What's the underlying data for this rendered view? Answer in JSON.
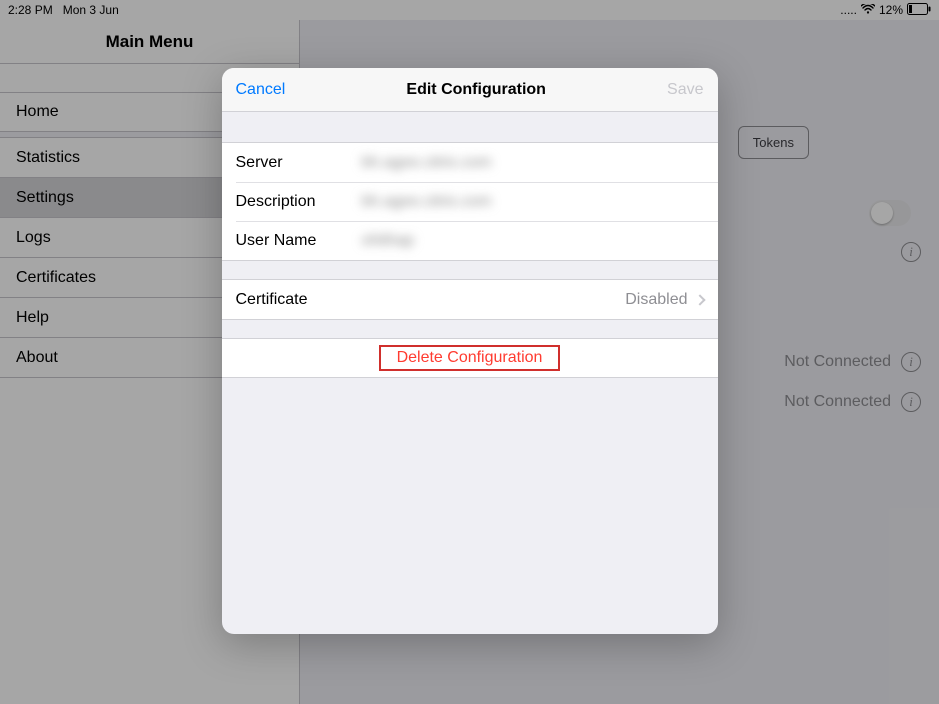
{
  "status": {
    "time": "2:28 PM",
    "date": "Mon 3 Jun",
    "cellular": ".....",
    "battery_pct": "12%"
  },
  "sidebar": {
    "title": "Main Menu",
    "items": [
      {
        "label": "Home"
      },
      {
        "label": "Statistics"
      },
      {
        "label": "Settings"
      },
      {
        "label": "Logs"
      },
      {
        "label": "Certificates"
      },
      {
        "label": "Help"
      },
      {
        "label": "About"
      }
    ]
  },
  "detail": {
    "tokens_button": "Tokens",
    "info_i": "i",
    "rows": [
      {
        "status": "Not Connected"
      },
      {
        "status": "Not Connected"
      }
    ]
  },
  "modal": {
    "cancel": "Cancel",
    "title": "Edit Configuration",
    "save": "Save",
    "fields": {
      "server_label": "Server",
      "server_value": "bh.agee.citrix.com",
      "description_label": "Description",
      "description_value": "bh.agee.citrix.com",
      "username_label": "User Name",
      "username_value": "ohithap"
    },
    "certificate": {
      "label": "Certificate",
      "status": "Disabled"
    },
    "delete_label": "Delete Configuration"
  }
}
